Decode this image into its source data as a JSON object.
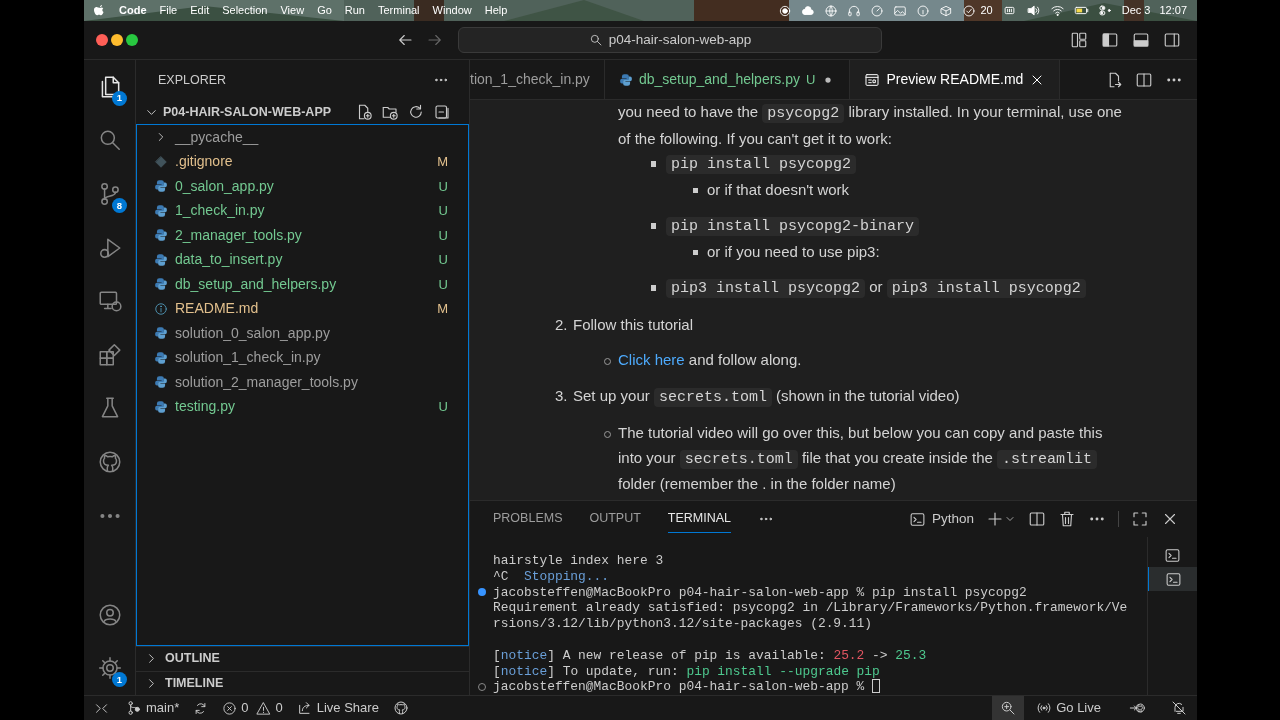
{
  "menu_bar": {
    "app": "Code",
    "menus": [
      "File",
      "Edit",
      "Selection",
      "View",
      "Go",
      "Run",
      "Terminal",
      "Window",
      "Help"
    ],
    "counter": "20",
    "date": "Dec 3",
    "time": "12:07"
  },
  "title_bar": {
    "search": "p04-hair-salon-web-app"
  },
  "activity_bar": {
    "top": [
      {
        "kind": "files",
        "selected": true,
        "badge": "1"
      },
      {
        "kind": "search",
        "selected": false
      },
      {
        "kind": "source-control",
        "selected": false,
        "badge": "8"
      },
      {
        "kind": "run-debug",
        "selected": false
      },
      {
        "kind": "remote",
        "selected": false
      },
      {
        "kind": "extensions",
        "selected": false
      },
      {
        "kind": "testing",
        "selected": false
      },
      {
        "kind": "github",
        "selected": false
      },
      {
        "kind": "more",
        "selected": false
      }
    ],
    "bottom": [
      {
        "kind": "account",
        "selected": false
      },
      {
        "kind": "settings",
        "selected": false,
        "badge": "1"
      }
    ]
  },
  "sidebar": {
    "title": "EXPLORER",
    "folder": {
      "name": "P04-HAIR-SALON-WEB-APP",
      "expanded": true
    },
    "files": [
      {
        "name": "__pycache__",
        "kind": "folder",
        "expanded": false
      },
      {
        "name": ".gitignore",
        "kind": "git",
        "status": "M"
      },
      {
        "name": "0_salon_app.py",
        "kind": "python",
        "status": "U"
      },
      {
        "name": "1_check_in.py",
        "kind": "python",
        "status": "U"
      },
      {
        "name": "2_manager_tools.py",
        "kind": "python",
        "status": "U"
      },
      {
        "name": "data_to_insert.py",
        "kind": "python",
        "status": "U"
      },
      {
        "name": "db_setup_and_helpers.py",
        "kind": "python",
        "status": "U"
      },
      {
        "name": "README.md",
        "kind": "info",
        "status": "M"
      },
      {
        "name": "solution_0_salon_app.py",
        "kind": "python"
      },
      {
        "name": "solution_1_check_in.py",
        "kind": "python"
      },
      {
        "name": "solution_2_manager_tools.py",
        "kind": "python"
      },
      {
        "name": "testing.py",
        "kind": "python",
        "status": "U"
      }
    ],
    "sections": [
      {
        "name": "OUTLINE",
        "expanded": false
      },
      {
        "name": "TIMELINE",
        "expanded": false
      }
    ]
  },
  "tabs": [
    {
      "label": "tion_1_check_in.py",
      "kind": "cut",
      "selected": false
    },
    {
      "label": "db_setup_and_helpers.py",
      "kind": "python",
      "status": "U",
      "dirty": true,
      "selected": false
    },
    {
      "label": "Preview README.md",
      "kind": "preview",
      "selected": true
    }
  ],
  "preview": {
    "items": [
      {
        "children": [
          {
            "continued": true,
            "parts": [
              {
                "text": "you need to have the "
              },
              {
                "code": "psycopg2"
              },
              {
                "text": " library installed. In your terminal, use one of the following. If you can't get it to work:"
              }
            ],
            "children": [
              {
                "parts": [
                  {
                    "code": "pip install psycopg2"
                  }
                ],
                "children": [
                  {
                    "parts": [
                      {
                        "text": "or if that doesn't work"
                      }
                    ]
                  }
                ]
              },
              {
                "parts": [
                  {
                    "code": "pip install psycopg2-binary"
                  }
                ],
                "children": [
                  {
                    "parts": [
                      {
                        "text": "or if you need to use pip3:"
                      }
                    ]
                  }
                ]
              },
              {
                "parts": [
                  {
                    "code": "pip3 install psycopg2"
                  },
                  {
                    "text": " or "
                  },
                  {
                    "code": "pip3 install psycopg2"
                  }
                ]
              }
            ]
          }
        ]
      },
      {
        "number": "2.",
        "parts": [
          {
            "text": "Follow this tutorial"
          }
        ],
        "children": [
          {
            "parts": [
              {
                "link": "Click here"
              },
              {
                "text": " and follow along."
              }
            ]
          }
        ]
      },
      {
        "number": "3.",
        "parts": [
          {
            "text": "Set up your "
          },
          {
            "code": "secrets.toml"
          },
          {
            "text": " (shown in the tutorial video)"
          }
        ],
        "children": [
          {
            "parts": [
              {
                "text": "The tutorial video will go over this, but below you can copy and paste this into your "
              },
              {
                "code": "secrets.toml"
              },
              {
                "text": " file that you create inside the "
              },
              {
                "code": ".streamlit"
              },
              {
                "text": " folder (remember the . in the folder name)"
              }
            ]
          }
        ]
      }
    ]
  },
  "panel": {
    "tabs": [
      {
        "label": "PROBLEMS",
        "selected": false
      },
      {
        "label": "OUTPUT",
        "selected": false
      },
      {
        "label": "TERMINAL",
        "selected": true
      }
    ],
    "terminal_name": "Python",
    "groups": [
      {
        "lines": [
          {
            "kind": "plain",
            "segments": [
              {
                "text": "hairstyle index here 3"
              }
            ]
          },
          {
            "kind": "plain",
            "segments": [
              {
                "text": "^C  "
              },
              {
                "text": "Stopping...",
                "color": "#6a9fd8"
              }
            ]
          },
          {
            "kind": "success",
            "segments": [
              {
                "text": "jacobsteffen@MacBookPro p04-hair-salon-web-app % pip install psycopg2"
              }
            ]
          },
          {
            "kind": "plain",
            "segments": [
              {
                "text": "Requirement already satisfied: psycopg2 in /Library/Frameworks/Python.framework/Ve"
              }
            ]
          },
          {
            "kind": "plain",
            "segments": [
              {
                "text": "rsions/3.12/lib/python3.12/site-packages (2.9.11)"
              }
            ]
          }
        ]
      },
      {
        "lines": [
          {
            "kind": "plain",
            "segments": [
              {
                "text": "["
              },
              {
                "text": "notice",
                "color": "#6a9fd8"
              },
              {
                "text": "] A new release of pip is available: "
              },
              {
                "text": "25.2",
                "color": "#e05561"
              },
              {
                "text": " -> "
              },
              {
                "text": "25.3",
                "color": "#4ec98f"
              }
            ]
          },
          {
            "kind": "plain",
            "segments": [
              {
                "text": "["
              },
              {
                "text": "notice",
                "color": "#6a9fd8"
              },
              {
                "text": "] To update, run: "
              },
              {
                "text": "pip install --upgrade pip",
                "color": "#4ec98f"
              }
            ]
          },
          {
            "kind": "idle",
            "cursor": true,
            "segments": [
              {
                "text": "jacobsteffen@MacBookPro p04-hair-salon-web-app % "
              }
            ]
          }
        ]
      }
    ],
    "instances": [
      {
        "selected": false
      },
      {
        "selected": true
      }
    ]
  },
  "status_bar": {
    "branch": "main*",
    "errors": "0",
    "warnings": "0",
    "live_share": "Live Share",
    "go_live": "Go Live"
  }
}
